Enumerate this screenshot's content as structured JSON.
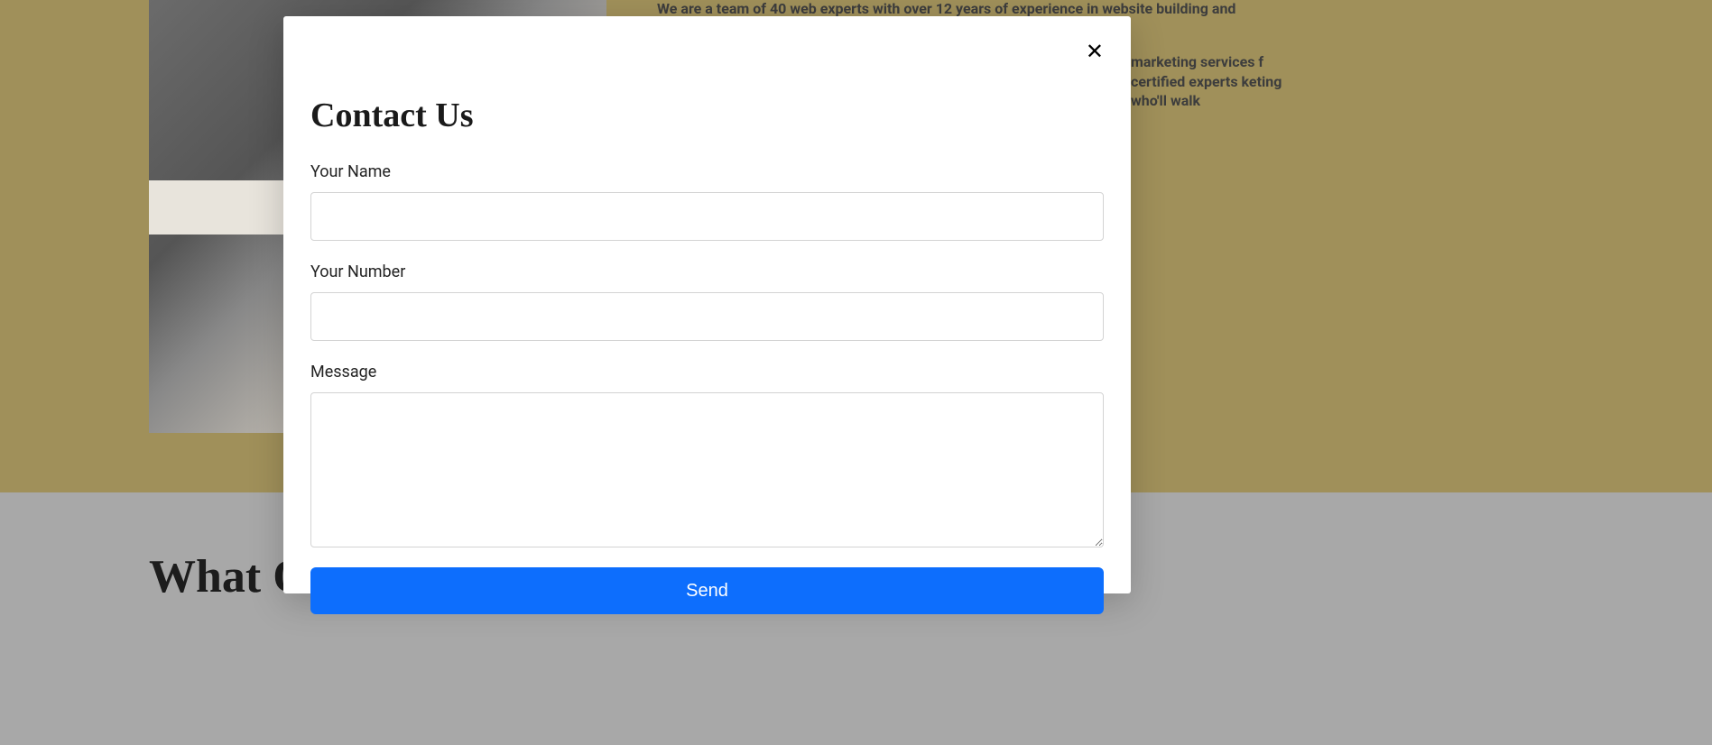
{
  "background": {
    "topText": "We are a team of 40 web experts with over 12 years of experience in website building and marketing to help businesses grow online",
    "rightText": "marketing services f certified experts keting who'll walk",
    "clientsHeading": "What Our Clients Say"
  },
  "modal": {
    "title": "Contact Us",
    "labels": {
      "name": "Your Name",
      "number": "Your Number",
      "message": "Message"
    },
    "submitLabel": "Send",
    "closeSymbol": "✕"
  }
}
